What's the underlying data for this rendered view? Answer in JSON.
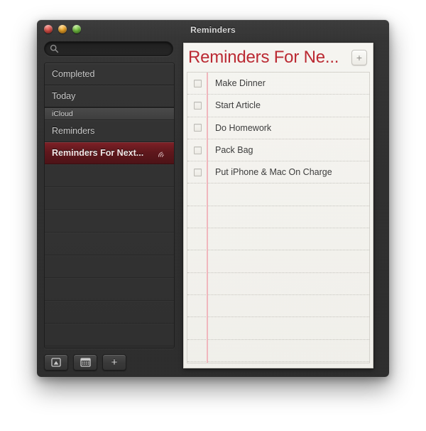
{
  "window": {
    "title": "Reminders",
    "traffic_lights": [
      "close",
      "minimize",
      "zoom"
    ]
  },
  "search": {
    "placeholder": "",
    "value": "",
    "icon": "search-icon"
  },
  "sidebar": {
    "items": [
      {
        "label": "Completed",
        "type": "smart",
        "selected": false
      },
      {
        "label": "Today",
        "type": "smart",
        "selected": false
      },
      {
        "label": "iCloud",
        "type": "group",
        "selected": false
      },
      {
        "label": "Reminders",
        "type": "list",
        "selected": false
      },
      {
        "label": "Reminders For Next...",
        "type": "list",
        "selected": true,
        "icon": "share-icon"
      }
    ],
    "toolbar": {
      "buttons": [
        {
          "name": "show-calendar-button",
          "icon": "monitor-icon",
          "label": ""
        },
        {
          "name": "calendar-grid-button",
          "icon": "calendar-grid-icon",
          "label": ""
        },
        {
          "name": "add-list-button",
          "icon": "plus-icon",
          "label": "+"
        }
      ]
    }
  },
  "main": {
    "list_title": "Reminders For Ne...",
    "add_button_label": "+",
    "reminders": [
      {
        "title": "Make Dinner",
        "checked": false
      },
      {
        "title": "Start Article",
        "checked": false
      },
      {
        "title": "Do Homework",
        "checked": false
      },
      {
        "title": "Pack Bag",
        "checked": false
      },
      {
        "title": "Put iPhone & Mac On Charge",
        "checked": false
      }
    ],
    "empty_rows": 11
  },
  "colors": {
    "accent_red": "#bb2a33",
    "selected_row": "#5e171c",
    "margin_line": "#f0b7bd",
    "paper": "#f4f3ee",
    "chrome": "#2f2f2f"
  }
}
